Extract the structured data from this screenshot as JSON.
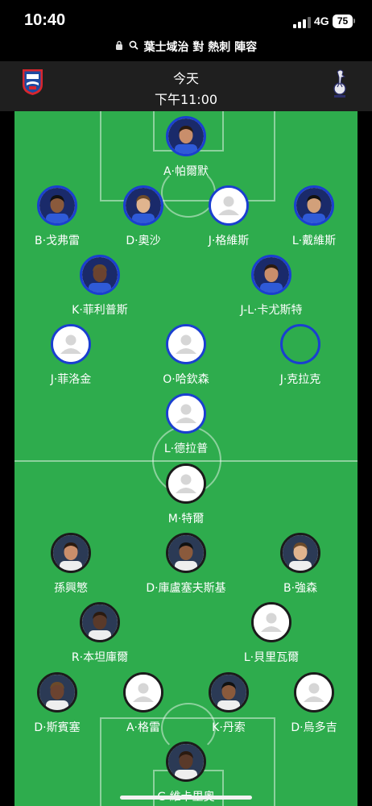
{
  "status_bar": {
    "time": "10:40",
    "network": "4G",
    "battery": "75"
  },
  "url_bar": {
    "title": "葉士域治 對 熱刺 陣容"
  },
  "match": {
    "day": "今天",
    "kickoff": "下午11:00",
    "home_crest_icon": "ipswich-town-crest-icon",
    "away_crest_icon": "tottenham-hotspur-crest-icon"
  },
  "colors": {
    "pitch": "#2eac4d",
    "home_ring": "#1a3fd0",
    "away_ring": "#1b1b1b"
  },
  "lineups": {
    "home": [
      {
        "name": "A·帕爾默",
        "photo": "photo"
      },
      {
        "name": "B·戈弗雷",
        "photo": "photo"
      },
      {
        "name": "D·奧沙",
        "photo": "photo"
      },
      {
        "name": "J·格維斯",
        "photo": "placeholder"
      },
      {
        "name": "L·戴維斯",
        "photo": "photo"
      },
      {
        "name": "K·菲利普斯",
        "photo": "photo"
      },
      {
        "name": "J-L·卡尤斯特",
        "photo": "photo"
      },
      {
        "name": "J·菲洛金",
        "photo": "placeholder"
      },
      {
        "name": "O·哈欽森",
        "photo": "placeholder"
      },
      {
        "name": "J·克拉克",
        "photo": "empty"
      },
      {
        "name": "L·德拉普",
        "photo": "placeholder"
      }
    ],
    "away": [
      {
        "name": "M·特爾",
        "photo": "placeholder"
      },
      {
        "name": "孫興慜",
        "photo": "photo"
      },
      {
        "name": "D·庫盧塞夫斯基",
        "photo": "photo"
      },
      {
        "name": "B·強森",
        "photo": "photo"
      },
      {
        "name": "R·本坦庫爾",
        "photo": "photo"
      },
      {
        "name": "L·貝里瓦爾",
        "photo": "placeholder"
      },
      {
        "name": "D·斯賓塞",
        "photo": "photo"
      },
      {
        "name": "A·格雷",
        "photo": "placeholder"
      },
      {
        "name": "K·丹索",
        "photo": "photo"
      },
      {
        "name": "D·烏多吉",
        "photo": "placeholder"
      },
      {
        "name": "G·維卡里奧",
        "photo": "photo"
      }
    ]
  }
}
